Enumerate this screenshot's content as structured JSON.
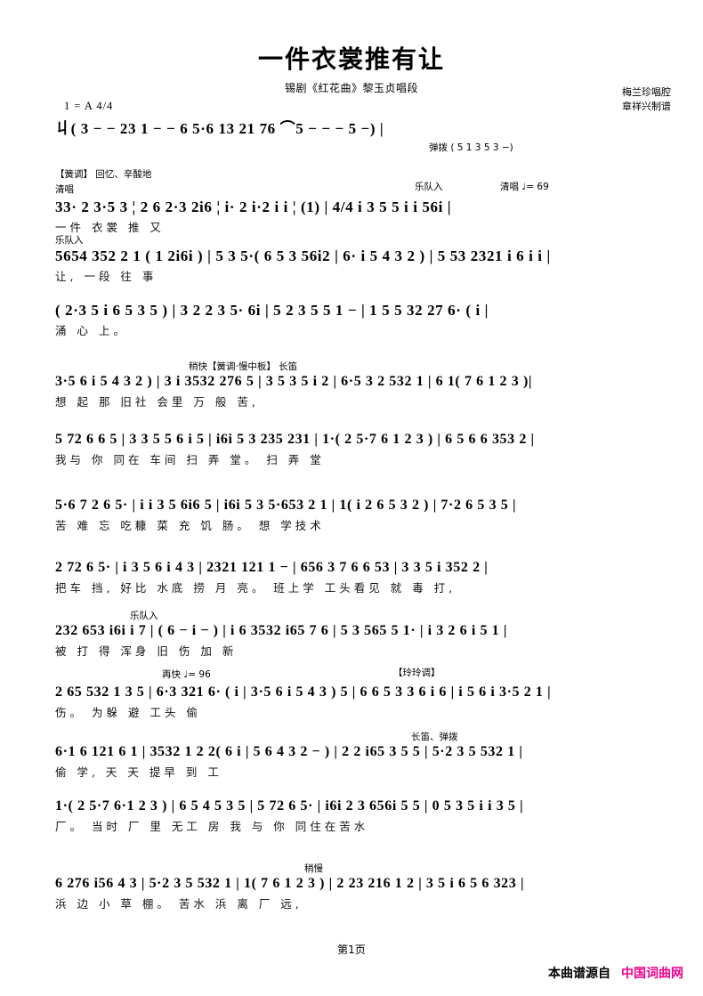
{
  "header": {
    "title": "一件衣裳推有让",
    "subtitle": "锡剧《红花曲》黎玉贞唱段",
    "credit_line1": "梅兰珍唱腔",
    "credit_line2": "章祥兴制谱",
    "key_signature": "1 = A  4/4"
  },
  "footer": {
    "page_label": "第1页",
    "source_prefix": "本曲谱源自",
    "source_site": "中国词曲网",
    "source_color": "#ec008c"
  },
  "systems": [
    {
      "id": "sys-1",
      "marks": [],
      "notes": "丩( 3 − − 23 1 − − 6 5·6 13 21 76 ⌒5 − − − 5 −) |",
      "notes_below": "弹拨 ( 5 1 3 5  3 −)",
      "lyrics": ""
    },
    {
      "id": "sys-2",
      "marks": [
        "【簧调】 回忆、辛酸地",
        "清唱",
        "乐队入",
        "清唱 ♩= 69"
      ],
      "notes": "33· 2 3·5 3 ¦ 2 6 2·3 2i6 ¦ i· 2 i·2 i i ¦ (1) | 4/4 i 3 5 5 i i 56i |",
      "lyrics": "一件 衣裳                                         推    又"
    },
    {
      "id": "sys-3",
      "marks": [
        "乐队入"
      ],
      "notes": "5654 352 2 1 ( 1 2i6i ) | 5 3 5·( 6 5 3 56i2 | 6· i 5 4 3 2 ) | 5 53 2321 i 6 i i |",
      "lyrics": "          让,                                                一段        往 事"
    },
    {
      "id": "sys-4",
      "marks": [],
      "notes": "( 2·3 5 i 6 5 3 5 ) | 3 2 2 3 5· 6i | 5 2 3 5 5 1 − | 1 5 5 32 27 6· ( i |",
      "lyrics": "            涌       心                            上。"
    },
    {
      "id": "sys-5",
      "marks": [
        "稍快【簧调·慢中板】 长笛"
      ],
      "notes": "3·5 6 i 5 4 3 2 ) | 3 i 3532 276 5 | 3 5 3 5 i 2 | 6·5 3 2 532 1 | 6 1( 7 6 1 2 3 )|",
      "lyrics": "            想 起 那   旧社 会里 万   般   苦,"
    },
    {
      "id": "sys-6",
      "marks": [],
      "notes": "5 72 6 6 5 | 3 3 5 5 6 i 5 | i6i 5 3 235 231 | 1·( 2 5·7 6 1 2 3 ) | 6 5 6 6 353 2 |",
      "lyrics": "我与 你   同在 车间 扫  弄   堂。            扫 弄 堂"
    },
    {
      "id": "sys-7",
      "marks": [],
      "notes": "5·6 7 2 6 5· | i i 3 5 6i6 5 | i6i 5 3 5·653 2 1 | 1( i 2 6 5 3 2 ) | 7·2 6 5 3 5 |",
      "lyrics": "苦 难 忘  吃糠 菜  充  饥   肠。        想  学技术"
    },
    {
      "id": "sys-8",
      "marks": [],
      "notes": "2 72 6 5· | i 3 5 6 i 4 3 | 2321 121 1 − | 656 3 7 6 6 53 | 3 3 5 i 352 2 |",
      "lyrics": "把车 挡, 好比 水底  捞 月 亮。 班上学 工头看见 就 毒 打,"
    },
    {
      "id": "sys-9",
      "marks": [
        "乐队入"
      ],
      "notes": "232 653 i6i i 7 | ( 6 − i − ) | i 6 3532 i65 7 6 | 5 3 565 5 1· | i 3 2 6 i 5 1 |",
      "lyrics": "被 打 得        浑身    旧  伤 加 新"
    },
    {
      "id": "sys-10",
      "marks": [
        "再快 ♩= 96",
        "【玲玲调】"
      ],
      "notes": "2 65 532 1 3 5 | 6·3 321 6· ( i | 3·5 6 i 5 4 3 ) 5 | 6 6 5 3 3 6 i 6 | i 5 6 i 3·5 2 1 |",
      "lyrics": "   伤。                  为躲 避 工头  偷"
    },
    {
      "id": "sys-11",
      "marks": [
        "长笛、弹拨"
      ],
      "notes": "6·1 6 121 6 1 | 3532 1 2 2( 6 i | 5 6 4 3 2 − ) | 2 2 i65 3 5 5 | 5·2 3 5 532 1 |",
      "lyrics": "偷      学,            天 天 提早 到  工"
    },
    {
      "id": "sys-12",
      "marks": [],
      "notes": "1·( 2 5·7 6·1 2 3 ) | 6 5 4 5 3 5 | 5 72 6 5· | i6i 2 3 656i 5 5 | 0 5 3 5 i i 3 5 |",
      "lyrics": "厂。        当时 厂 里 无工 房  我 与 你     同住在苦水"
    },
    {
      "id": "sys-13",
      "marks": [
        "稍慢"
      ],
      "notes": "6 276 i56 4 3 | 5·2 3 5 532 1 | 1( 7 6 1 2 3 ) | 2 23 216 1 2 | 3 5 i 6 5 6 323 |",
      "lyrics": "浜  边   小  草 棚。      苦水  浜  离 厂 远,"
    }
  ]
}
